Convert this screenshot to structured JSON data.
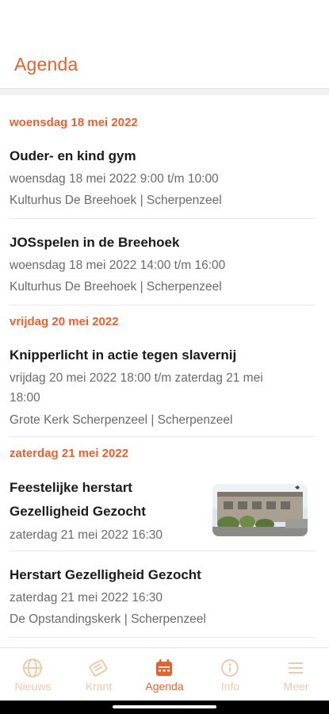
{
  "header": {
    "title": "Agenda"
  },
  "days": [
    {
      "label": "woensdag 18 mei 2022",
      "events": [
        {
          "title": "Ouder- en kind gym",
          "time": "woensdag 18 mei 2022 9:00 t/m 10:00",
          "location": "Kulturhus De Breehoek | Scherpenzeel"
        },
        {
          "title": "JOSspelen in de Breehoek",
          "time": "woensdag 18 mei 2022 14:00 t/m 16:00",
          "location": "Kulturhus De Breehoek | Scherpenzeel"
        }
      ]
    },
    {
      "label": "vrijdag 20 mei 2022",
      "events": [
        {
          "title": "Knipperlicht in actie tegen slavernij",
          "time_line1": "vrijdag 20 mei 2022 18:00 t/m zaterdag 21 mei",
          "time_line2": "18:00",
          "location": "Grote Kerk Scherpenzeel | Scherpenzeel"
        }
      ]
    },
    {
      "label": "zaterdag 21 mei 2022",
      "events": [
        {
          "title_line1": "Feestelijke herstart",
          "title_line2": "Gezelligheid Gezocht",
          "time": "zaterdag 21 mei 2022 16:30",
          "image": "building-photo"
        },
        {
          "title": "Herstart Gezelligheid Gezocht",
          "time": "zaterdag 21 mei 2022 16:30",
          "location": "De Opstandingskerk | Scherpenzeel"
        }
      ]
    }
  ],
  "tabs": [
    {
      "label": "Nieuws",
      "icon": "globe-icon",
      "active": false
    },
    {
      "label": "Krant",
      "icon": "newspaper-icon",
      "active": false
    },
    {
      "label": "Agenda",
      "icon": "calendar-icon",
      "active": true
    },
    {
      "label": "Info",
      "icon": "info-icon",
      "active": false
    },
    {
      "label": "Meer",
      "icon": "menu-icon",
      "active": false
    }
  ],
  "colors": {
    "accent": "#e8612c",
    "inactive_tab": "#f0c9a8",
    "secondary_text": "#6a6a6a"
  }
}
